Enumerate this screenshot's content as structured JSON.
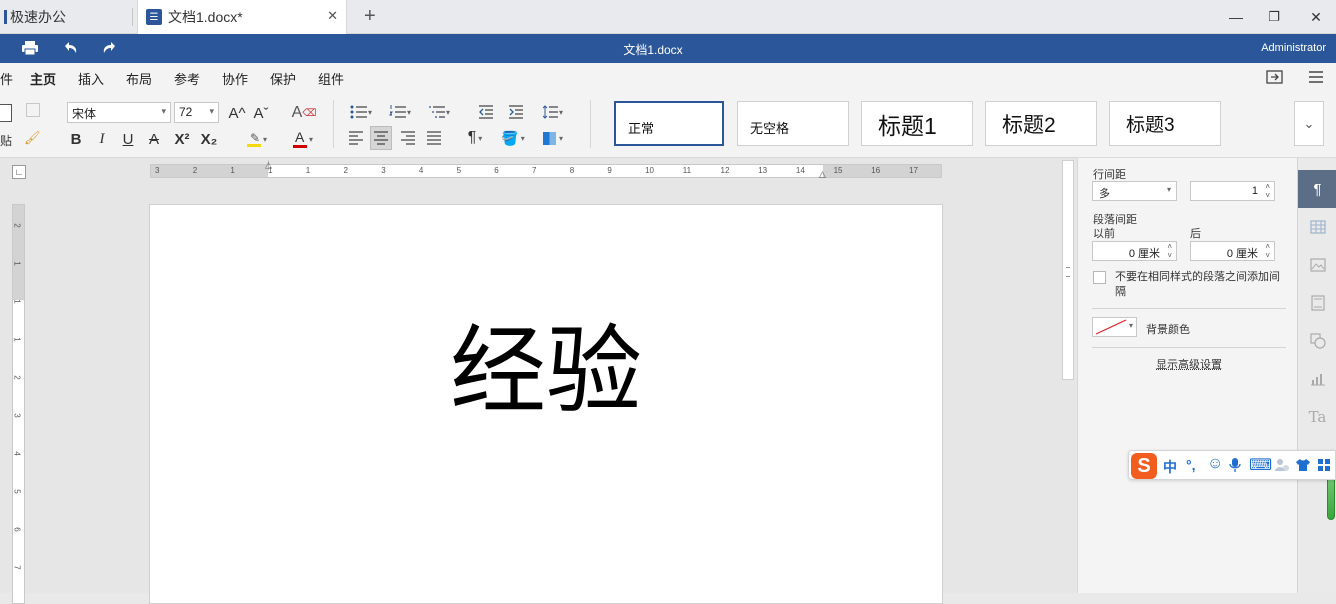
{
  "tabs": [
    {
      "label": "极速办公"
    },
    {
      "label": "文档1.docx*"
    }
  ],
  "new_tab_icon": "+",
  "window_controls": {
    "minimize": "—",
    "maximize": "❐",
    "close": "✕"
  },
  "topbar": {
    "doc_title": "文档1.docx",
    "user": "Administrator"
  },
  "menu": {
    "items": [
      "件",
      "主页",
      "插入",
      "布局",
      "参考",
      "协作",
      "保护",
      "组件"
    ],
    "active_index": 1
  },
  "toolbar": {
    "paste_label": "贴",
    "font_name": "宋体",
    "font_size": "72",
    "bold": "B",
    "italic": "I",
    "underline": "U",
    "strike": "A",
    "superscript": "X²",
    "subscript": "X₂",
    "grow_font": "A^",
    "shrink_font": "Aˇ",
    "font_color_letter": "A",
    "pilcrow": "¶"
  },
  "styles": [
    {
      "label": "正常",
      "active": true
    },
    {
      "label": "无空格"
    },
    {
      "label": "标题1"
    },
    {
      "label": "标题2"
    },
    {
      "label": "标题3"
    }
  ],
  "ruler": {
    "h_numbers": [
      "3",
      "2",
      "1",
      "1",
      "1",
      "2",
      "3",
      "4",
      "5",
      "6",
      "7",
      "8",
      "9",
      "10",
      "11",
      "12",
      "13",
      "14",
      "15",
      "16",
      "17"
    ],
    "v_numbers": [
      "2",
      "1",
      "1",
      "1",
      "2",
      "3",
      "4",
      "5",
      "6",
      "7"
    ]
  },
  "document": {
    "text": "经验"
  },
  "paragraph_panel": {
    "line_spacing_label": "行间距",
    "line_spacing_type": "多",
    "line_spacing_value": "1",
    "para_spacing_label": "段落间距",
    "before_label": "以前",
    "after_label": "后",
    "before_value": "0 厘米",
    "after_value": "0 厘米",
    "checkbox_label": "不要在相同样式的段落之间添加间隔",
    "bg_color_label": "背景颜色",
    "advanced_link": "显示高级设置"
  },
  "ime_bar": {
    "logo": "S",
    "mode": "中",
    "punct": "°,",
    "emoji": "☺",
    "mic": "🎤",
    "keyboard": "⌨"
  },
  "colors": {
    "brand_blue": "#2b579a",
    "highlight_yellow": "#f5d90a",
    "font_color_red": "#d00000",
    "ime_orange": "#f25c1f"
  }
}
